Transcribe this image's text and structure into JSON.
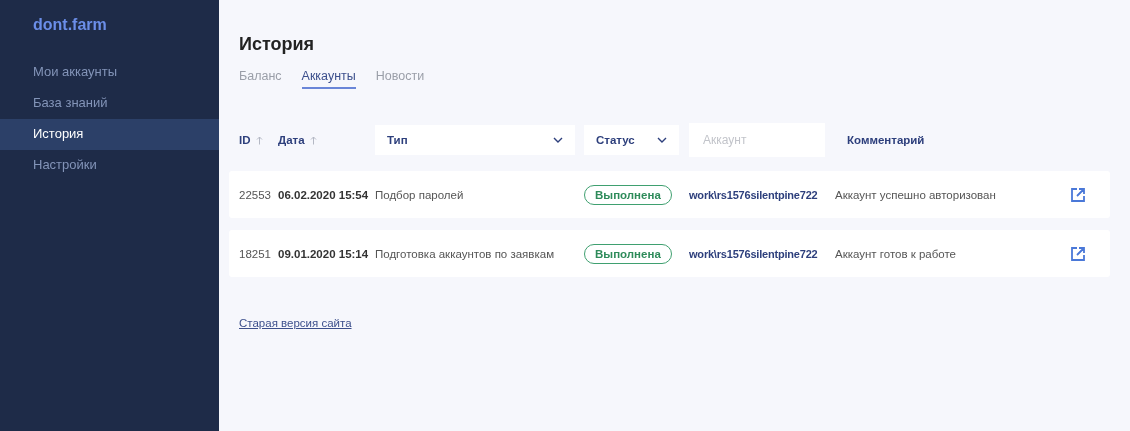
{
  "sidebar": {
    "logo": "dont.farm",
    "items": [
      {
        "label": "Мои аккаунты",
        "selected": false
      },
      {
        "label": "База знаний",
        "selected": false
      },
      {
        "label": "История",
        "selected": true
      },
      {
        "label": "Настройки",
        "selected": false
      }
    ]
  },
  "page": {
    "title": "История",
    "tabs": [
      {
        "label": "Баланс",
        "selected": false
      },
      {
        "label": "Аккаунты",
        "selected": true
      },
      {
        "label": "Новости",
        "selected": false
      }
    ]
  },
  "table": {
    "columns": [
      {
        "kind": "sort",
        "label": "ID"
      },
      {
        "kind": "sort",
        "label": "Дата"
      },
      {
        "kind": "select",
        "label": "Тип"
      },
      {
        "kind": "select",
        "label": "Статус"
      },
      {
        "kind": "input",
        "placeholder": "Аккаунт"
      },
      {
        "kind": "label",
        "label": "Комментарий"
      }
    ],
    "rows": [
      {
        "id": "22553",
        "date": "06.02.2020 15:54",
        "type": "Подбор паролей",
        "status": "Выполнена",
        "account": "work\\rs1576silentpine722",
        "comment": "Аккаунт успешно авторизован"
      },
      {
        "id": "18251",
        "date": "09.01.2020 15:14",
        "type": "Подготовка аккаунтов по заявкам",
        "status": "Выполнена",
        "account": "work\\rs1576silentpine722",
        "comment": "Аккаунт готов к работе"
      }
    ]
  },
  "footer_link": "Старая версия сайта"
}
